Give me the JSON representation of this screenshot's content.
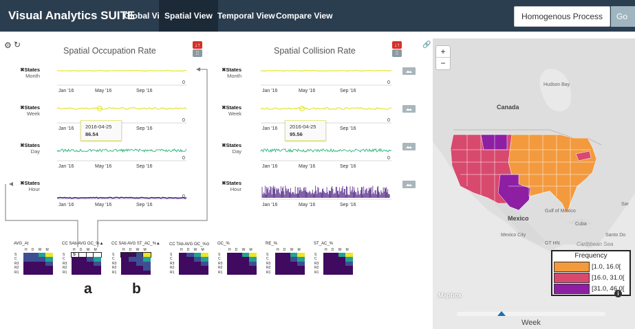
{
  "navbar": {
    "brand": "Visual Analytics SUITE",
    "tabs": [
      {
        "label": "Global View",
        "active": false
      },
      {
        "label": "Spatial View",
        "active": true
      },
      {
        "label": "Temporal View",
        "active": false
      },
      {
        "label": "Compare View",
        "active": false
      }
    ],
    "process_value": "Homogenous Process",
    "go_label": "Go"
  },
  "toolbar": {
    "settings_icon": "gear-icon",
    "refresh_icon": "refresh-icon",
    "link_icon": "link-icon"
  },
  "charts": {
    "occupation": {
      "title": "Spatial Occupation Rate"
    },
    "collision": {
      "title": "Spatial Collision Rate"
    },
    "rows": [
      {
        "close": "✖",
        "name": "States",
        "unit": "Month"
      },
      {
        "close": "✖",
        "name": "States",
        "unit": "Week"
      },
      {
        "close": "✖",
        "name": "States",
        "unit": "Day"
      },
      {
        "close": "✖",
        "name": "States",
        "unit": "Hour"
      }
    ],
    "x_ticks": [
      "Jan '16",
      "May '16",
      "Sep '16"
    ],
    "y_zero": "0",
    "tooltips": [
      {
        "date": "2016-04-25",
        "value": "86.54"
      },
      {
        "date": "2016-04-25",
        "value": "95.56"
      }
    ],
    "colors": {
      "yellow": "#e5e52a",
      "green": "#2fb37a",
      "purple": "#4b1d82"
    }
  },
  "heatmaps": {
    "items": [
      {
        "label": "AVG_At"
      },
      {
        "label": "CC SAb AVG OC_%▲"
      },
      {
        "label": "CC SAb AVG ST_AC_%▲"
      },
      {
        "label": "CC TAb AVG OC_%⊙"
      },
      {
        "label": "OC_%"
      },
      {
        "label": "RE_%"
      },
      {
        "label": "ST_AC_%"
      }
    ],
    "col_headers": "H D W M",
    "row_headers": [
      "S",
      "C",
      "R3",
      "R2",
      "R1"
    ],
    "selected_cell": "S",
    "colors": {
      "dark": "#3f0a60",
      "mid": "#3d4f92",
      "teal": "#23a296",
      "yellow": "#efe524"
    }
  },
  "annotations": {
    "a": "a",
    "b": "b"
  },
  "map": {
    "zoom_in": "+",
    "zoom_out": "−",
    "labels": {
      "hudson_bay": "Hudson Bay",
      "canada": "Canada",
      "mexico": "Mexico",
      "gulf": "Gulf of Mexico",
      "cuba": "Cuba",
      "mexico_city": "Mexico City",
      "gt_hn": "GT HN",
      "caribbean": "Caribbean Sea",
      "santo": "Santo Do",
      "sar": "Sar"
    },
    "attribution": "Mapbox",
    "legend": {
      "title": "Frequency",
      "entries": [
        {
          "label": "[1.0, 16.0[",
          "color": "#f39a3e"
        },
        {
          "label": "[16.0, 31.0[",
          "color": "#d8496e"
        },
        {
          "label": "[31.0, 46.0[",
          "color": "#8e1fa3"
        }
      ]
    },
    "info": "i",
    "slider_label": "Week",
    "slider_value_fraction": 0.3
  }
}
